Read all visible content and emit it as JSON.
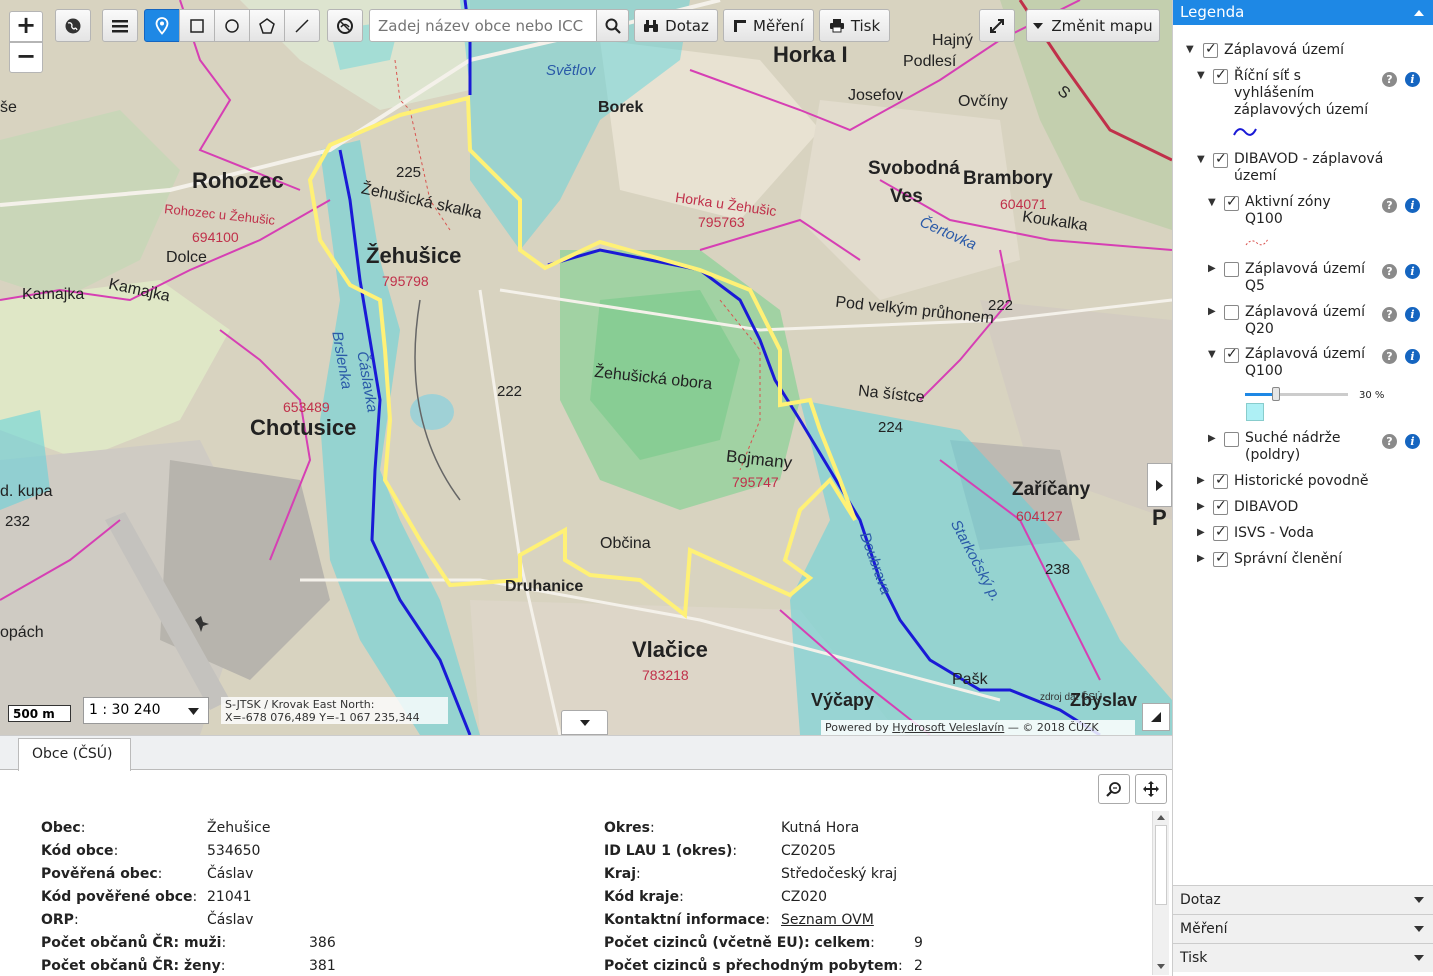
{
  "toolbar": {
    "zoom_in": "+",
    "zoom_out": "−",
    "search_placeholder": "Zadej název obce nebo ICC",
    "query_label": "Dotaz",
    "measure_label": "Měření",
    "print_label": "Tisk",
    "change_map_label": "Změnit mapu"
  },
  "map": {
    "labels": {
      "rohozec": "Rohozec",
      "rohozec_u": "Rohozec u Žehušic",
      "rohozec_code": "694100",
      "zehusice": "Žehušice",
      "zehusice_code": "795798",
      "zehusicka_skalka": "Žehušická skalka",
      "elev_225": "225",
      "dolce": "Dolce",
      "kamajka1": "Kamajka",
      "kamajka2": "Kamajka",
      "chotusice": "Chotusice",
      "chotusice_code": "653489",
      "kupa": "d. kupa",
      "elev_232": "232",
      "opach": "opách",
      "brslenka": "Brslenka",
      "caslavka": "Čáslavka",
      "elev_222a": "222",
      "zehusicka_obora": "Žehušická obora",
      "bojmany": "Bojmany",
      "bojmany_code": "795747",
      "obcina": "Občina",
      "druhanice": "Druhanice",
      "vlacice": "Vlačice",
      "vlacice_code": "783218",
      "horka": "Horka I",
      "horka_u": "Horka u Žehušic",
      "horka_code": "795763",
      "svetlov": "Světlov",
      "borek": "Borek",
      "josefov": "Josefov",
      "hajny": "Hajný",
      "podlesi": "Podlesí",
      "ovciny": "Ovčíny",
      "svobodna": "Svobodná",
      "ves": "Ves",
      "brambory": "Brambory",
      "brambory_code": "604071",
      "koukalka": "Koukalka",
      "certovka": "Čertovka",
      "elev_222b": "222",
      "pod_velkym": "Pod velkým průhonem",
      "na_sistce": "Na šístce",
      "elev_224": "224",
      "zaricany": "Zaříčany",
      "zaricany_code": "604127",
      "starkocsky": "Starkočský p.",
      "doubrava": "Doubrava",
      "elev_238": "238",
      "vycapy": "Výčapy",
      "zbyslav": "Zbyslav",
      "pasko": "Pašk",
      "zdroj": "zdroj dat ČSÚ",
      "edge_se": "še",
      "edge_s": "S",
      "edge_p": "P"
    },
    "scale_label": "500 m",
    "ratio": "1 : 30 240",
    "coords_line1": "S-JTSK / Krovak East North:",
    "coords_line2": "X=-678 076,489 Y=-1 067 235,344",
    "powered_prefix": "Powered by ",
    "powered_link": "Hydrosoft Veleslavín",
    "powered_suffix": " — © 2018 ČÚZK"
  },
  "legend": {
    "title": "Legenda",
    "items": {
      "zaplavova": "Záplavová území",
      "ricni": "Říční síť s vyhlášením záplavových území",
      "dibavod_zap": "DIBAVOD - záplavová území",
      "aktivni": "Aktivní zóny Q100",
      "q5": "Záplavová území Q5",
      "q20": "Záplavová území Q20",
      "q100": "Záplavová území Q100",
      "opacity": "30 %",
      "suche": "Suché nádrže (poldry)",
      "historicke": "Historické povodně",
      "dibavod": "DIBAVOD",
      "isvs": "ISVS - Voda",
      "spravni": "Správní členění"
    },
    "q100_opacity_fraction": 0.3,
    "accordion": [
      "Dotaz",
      "Měření",
      "Tisk"
    ]
  },
  "panel": {
    "tab": "Obce (ČSÚ)",
    "left": [
      {
        "k": "Obec",
        "v": "Žehušice"
      },
      {
        "k": "Kód obce",
        "v": "534650"
      },
      {
        "k": "Pověřená obec",
        "v": "Čáslav"
      },
      {
        "k": "Kód pověřené obce",
        "v": "21041"
      },
      {
        "k": "ORP",
        "v": "Čáslav"
      },
      {
        "k": "Počet občanů ČR: muži",
        "v": "386"
      },
      {
        "k": "Počet občanů ČR: ženy",
        "v": "381"
      }
    ],
    "right": [
      {
        "k": "Okres",
        "v": "Kutná Hora"
      },
      {
        "k": "ID LAU 1 (okres)",
        "v": "CZ0205"
      },
      {
        "k": "Kraj",
        "v": "Středočeský kraj"
      },
      {
        "k": "Kód kraje",
        "v": "CZ020"
      },
      {
        "k": "Kontaktní informace",
        "v": "Seznam OVM"
      },
      {
        "k": "Počet cizinců (včetně EU): celkem",
        "v": "9"
      },
      {
        "k": "Počet cizinců s přechodným pobytem",
        "v": "2"
      }
    ]
  }
}
